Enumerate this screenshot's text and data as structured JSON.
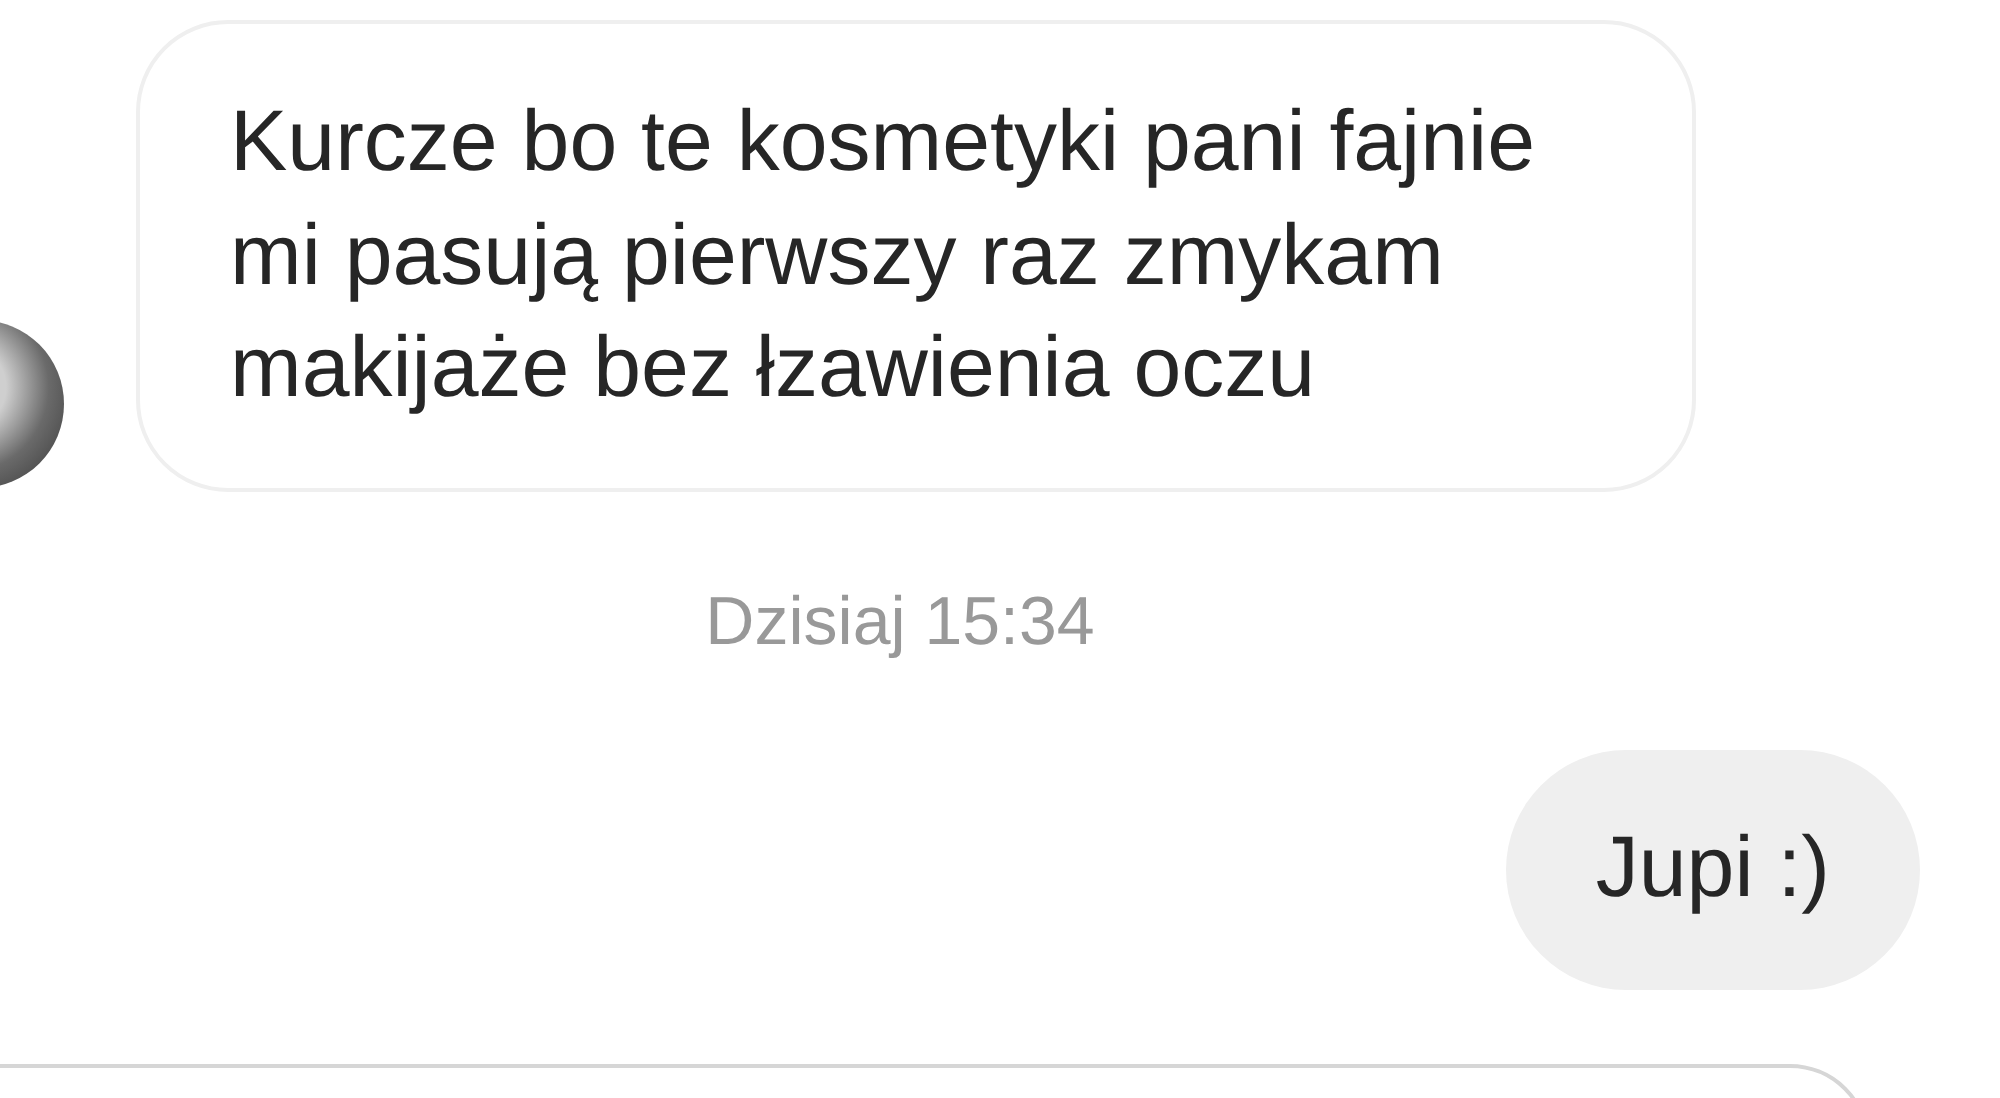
{
  "messages": [
    {
      "kind": "received",
      "text": "Kurcze bo te kosmetyki pani fajnie mi pasują pierwszy raz zmykam makijaże bez łzawienia oczu"
    },
    {
      "kind": "timestamp",
      "text": "Dzisiaj 15:34"
    },
    {
      "kind": "sent",
      "text": "Jupi :)"
    }
  ]
}
